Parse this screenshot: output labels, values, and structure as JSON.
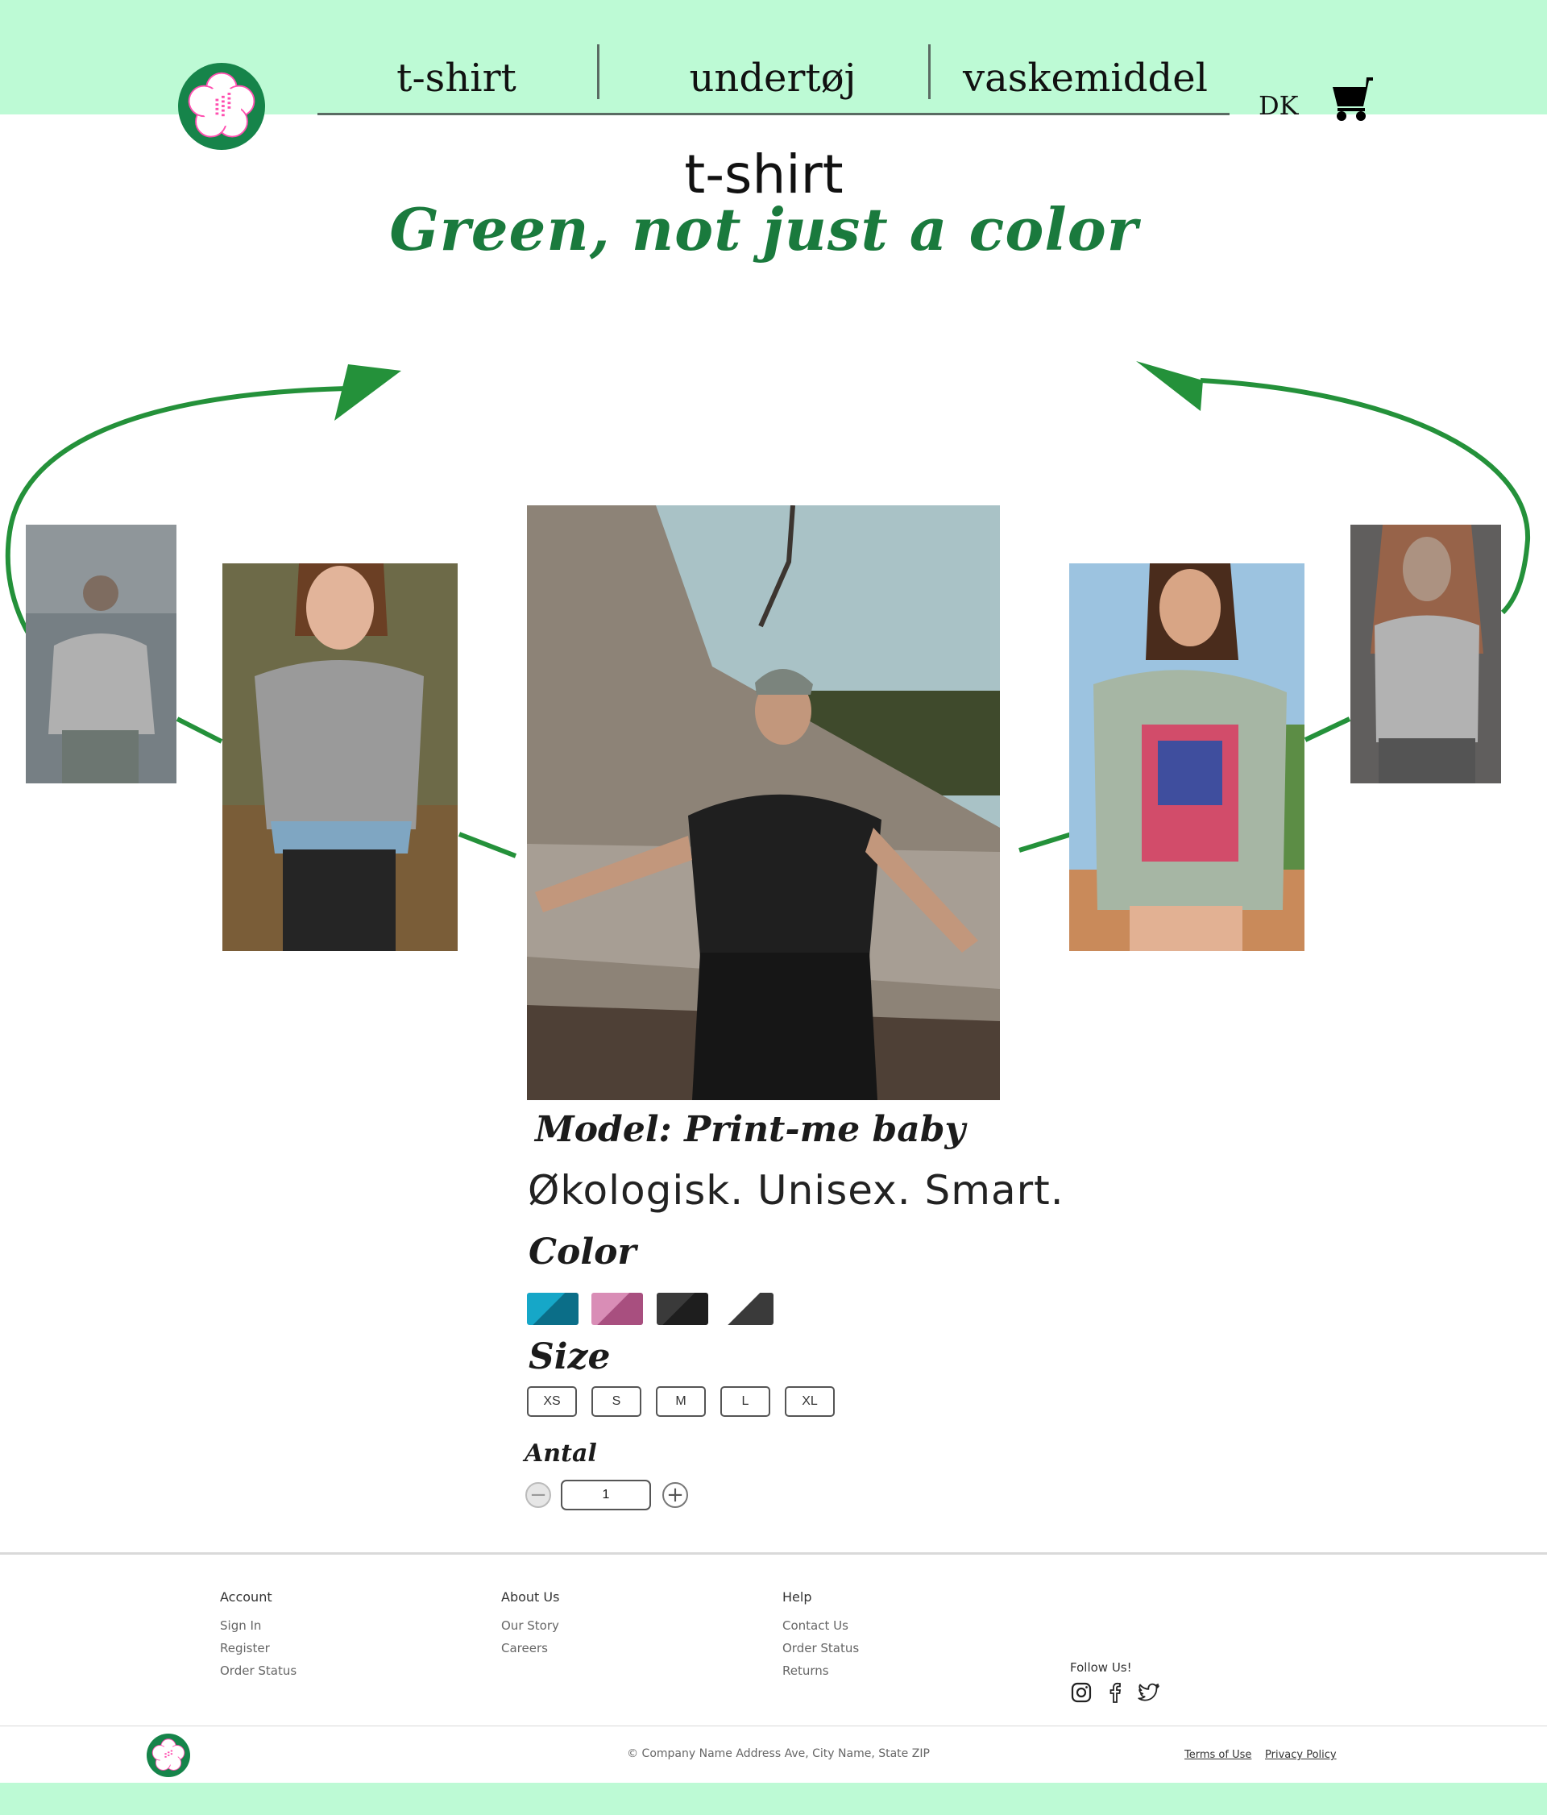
{
  "header": {
    "nav": [
      {
        "label": "t-shirt"
      },
      {
        "label": "undertøj"
      },
      {
        "label": "vaskemiddel"
      }
    ],
    "language": "DK",
    "cart_icon": "cart-icon",
    "logo_text": "大変よくできました"
  },
  "hero": {
    "title": "t-shirt",
    "subtitle": "Green, not just a color"
  },
  "carousel": {
    "arrow_color": "#24913a",
    "photos": [
      "man-back-white-tee",
      "woman-grey-tee",
      "man-black-tee-driftwood",
      "woman-graphic-tee",
      "woman-white-tee"
    ]
  },
  "product": {
    "model": "Model: Print-me baby",
    "tagline": "Økologisk. Unisex. Smart.",
    "color_label": "Color",
    "colors": [
      "#0f8fb0",
      "#c97ba4",
      "#2b2b2b",
      "#f2f2f2"
    ],
    "size_label": "Size",
    "sizes": [
      "XS",
      "S",
      "M",
      "L",
      "XL"
    ],
    "quantity_label": "Antal",
    "quantity": "1"
  },
  "footer": {
    "columns": [
      {
        "heading": "Account",
        "links": [
          "Sign In",
          "Register",
          "Order Status"
        ]
      },
      {
        "heading": "About Us",
        "links": [
          "Our Story",
          "Careers"
        ]
      },
      {
        "heading": "Help",
        "links": [
          "Contact Us",
          "Order Status",
          "Returns"
        ]
      }
    ],
    "follow": "Follow Us!",
    "social_icons": [
      "instagram-icon",
      "facebook-icon",
      "twitter-icon"
    ],
    "copyright": "© Company Name Address Ave, City Name, State ZIP",
    "terms": "Terms of Use",
    "privacy": "Privacy Policy"
  },
  "colors": {
    "brand_green": "#16844a",
    "mint": "#bdfad5",
    "accent_green": "#1a7a3d"
  }
}
